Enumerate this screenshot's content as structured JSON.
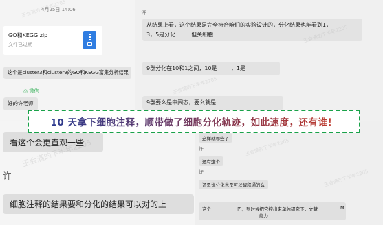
{
  "left_chat": {
    "timestamp": "4月25日 14:06",
    "file": {
      "name": "GO和KEGG.zip",
      "status": "文件已过期"
    },
    "message_cluster": "这个是cluster3和cluster9的GO和KEGG富集分析结果",
    "source_label": "微信",
    "message_teacher": "好的许老师"
  },
  "right_chat": {
    "sender": "许",
    "message_1_line1": "从结果上看，这个结果是完全符合咱们的实验设计的，分化结果也能看到1，",
    "message_1_line2": "3，5是分化         但关细胞",
    "message_2": "9群分化在10和1之间，10是        ，1是",
    "message_3": "9群要么是中间态，要么就是"
  },
  "banner": {
    "text": "10 天拿下细胞注释，顺带做了细胞分化轨迹，如此速度，还有谁！"
  },
  "zoom_left": {
    "message_1": "看这个会更直观一些",
    "sender": "许",
    "message_2": "细胞注释的结果要和分化的结果可以对的上"
  },
  "zoom_right": {
    "source_label": "微信",
    "message_1": "这样就哪些了",
    "sender_1": "许",
    "message_2": "还有这个",
    "sender_2": "许",
    "message_3": "还是说分化也是可以解释通的么",
    "message_4_col1": "这个",
    "message_4_col2": "巴，到时候把它控出来单独研究下，文献",
    "message_4_col3": "能力",
    "message_4_tail": "M"
  },
  "watermark_text": "王会满的下半年2205",
  "colors": {
    "banner_border": "#1aa24a",
    "banner_text_start": "#2b3a8f",
    "banner_text_end": "#c0392b",
    "source_green": "#3db35f",
    "file_icon_blue": "#2f7de1"
  },
  "icons": [
    "zip-file-icon",
    "wechat-icon"
  ]
}
